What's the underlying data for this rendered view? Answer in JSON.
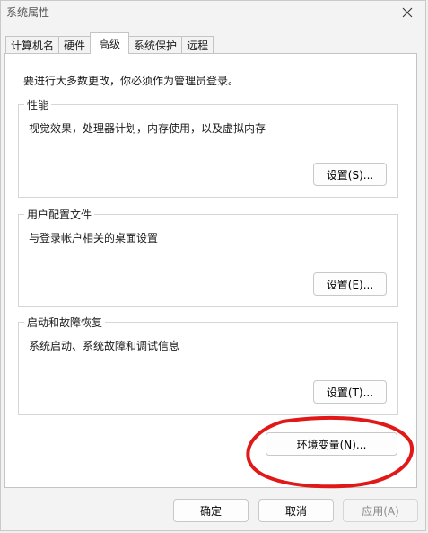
{
  "window": {
    "title": "系统属性",
    "close_icon": "close-icon"
  },
  "tabs": [
    {
      "label": "计算机名"
    },
    {
      "label": "硬件"
    },
    {
      "label": "高级",
      "active": true
    },
    {
      "label": "系统保护"
    },
    {
      "label": "远程"
    }
  ],
  "advanced": {
    "admin_note": "要进行大多数更改，你必须作为管理员登录。",
    "performance": {
      "title": "性能",
      "description": "视觉效果，处理器计划，内存使用，以及虚拟内存",
      "button": "设置(S)..."
    },
    "user_profiles": {
      "title": "用户配置文件",
      "description": "与登录帐户相关的桌面设置",
      "button": "设置(E)..."
    },
    "startup_recovery": {
      "title": "启动和故障恢复",
      "description": "系统启动、系统故障和调试信息",
      "button": "设置(T)..."
    },
    "env_vars_button": "环境变量(N)..."
  },
  "footer": {
    "ok": "确定",
    "cancel": "取消",
    "apply": "应用(A)"
  },
  "colors": {
    "annotation": "#e01818"
  }
}
